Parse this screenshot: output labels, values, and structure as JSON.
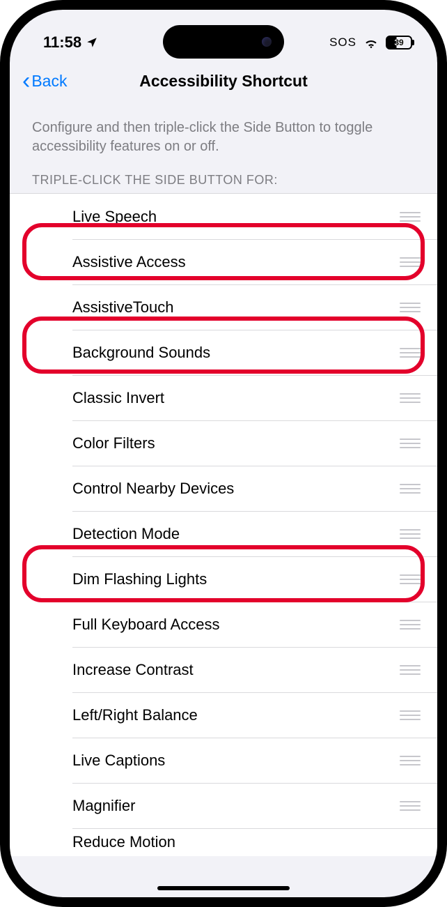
{
  "status": {
    "time": "11:58",
    "sos": "SOS",
    "battery": "39"
  },
  "nav": {
    "back_label": "Back",
    "title": "Accessibility Shortcut"
  },
  "intro": "Configure and then triple-click the Side Button to toggle accessibility features on or off.",
  "section_header": "TRIPLE-CLICK THE SIDE BUTTON FOR:",
  "items": [
    {
      "label": "Live Speech",
      "highlighted": true
    },
    {
      "label": "Assistive Access",
      "highlighted": false
    },
    {
      "label": "AssistiveTouch",
      "highlighted": true
    },
    {
      "label": "Background Sounds",
      "highlighted": false
    },
    {
      "label": "Classic Invert",
      "highlighted": false
    },
    {
      "label": "Color Filters",
      "highlighted": false
    },
    {
      "label": "Control Nearby Devices",
      "highlighted": false
    },
    {
      "label": "Detection Mode",
      "highlighted": true
    },
    {
      "label": "Dim Flashing Lights",
      "highlighted": false
    },
    {
      "label": "Full Keyboard Access",
      "highlighted": false
    },
    {
      "label": "Increase Contrast",
      "highlighted": false
    },
    {
      "label": "Left/Right Balance",
      "highlighted": false
    },
    {
      "label": "Live Captions",
      "highlighted": false
    },
    {
      "label": "Magnifier",
      "highlighted": false
    },
    {
      "label": "Reduce Motion",
      "highlighted": false
    }
  ]
}
